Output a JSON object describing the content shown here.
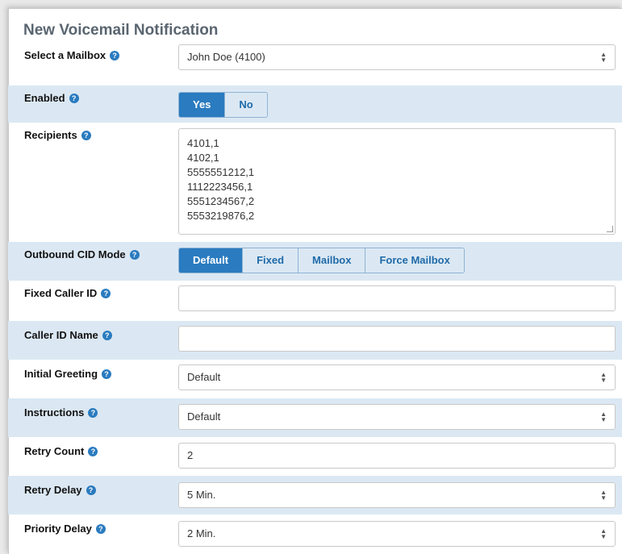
{
  "title": "New Voicemail Notification",
  "fields": {
    "mailbox": {
      "label": "Select a Mailbox",
      "value": "John Doe (4100)"
    },
    "enabled": {
      "label": "Enabled",
      "options": [
        "Yes",
        "No"
      ],
      "selected": "Yes"
    },
    "recipients": {
      "label": "Recipients",
      "lines": [
        "4101,1",
        "4102,1",
        "5555551212,1",
        "1112223456,1",
        "5551234567,2",
        "5553219876,2"
      ]
    },
    "cid_mode": {
      "label": "Outbound CID Mode",
      "options": [
        "Default",
        "Fixed",
        "Mailbox",
        "Force Mailbox"
      ],
      "selected": "Default"
    },
    "fixed_cid": {
      "label": "Fixed Caller ID",
      "value": ""
    },
    "cid_name": {
      "label": "Caller ID Name",
      "value": ""
    },
    "greeting": {
      "label": "Initial Greeting",
      "value": "Default"
    },
    "instructions": {
      "label": "Instructions",
      "value": "Default"
    },
    "retry_count": {
      "label": "Retry Count",
      "value": "2"
    },
    "retry_delay": {
      "label": "Retry Delay",
      "value": "5 Min."
    },
    "priority_delay": {
      "label": "Priority Delay",
      "value": "2 Min."
    }
  },
  "help_glyph": "?"
}
